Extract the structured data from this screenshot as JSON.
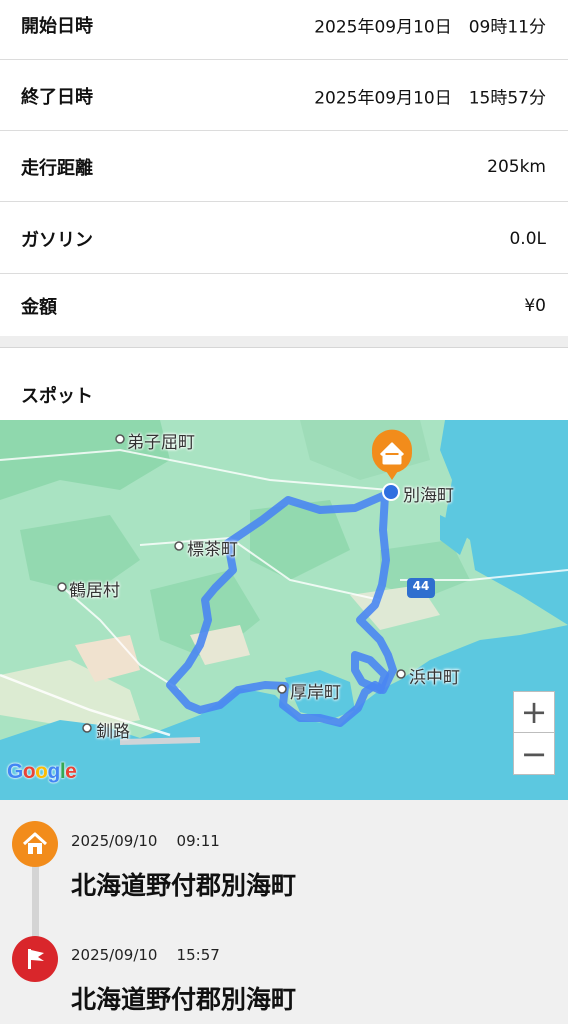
{
  "summary": {
    "start": {
      "label": "開始日時",
      "value": "2025年09月10日　09時11分"
    },
    "end": {
      "label": "終了日時",
      "value": "2025年09月10日　15時57分"
    },
    "distance": {
      "label": "走行距離",
      "value": "205km"
    },
    "gasoline": {
      "label": "ガソリン",
      "value": "0.0L"
    },
    "amount": {
      "label": "金額",
      "value": "¥0"
    }
  },
  "spot": {
    "title": "スポット",
    "map": {
      "labels": {
        "teshikaga": "弟子屈町",
        "betsukai": "別海町",
        "shibecha": "標茶町",
        "tsurui": "鶴居村",
        "hamanaka": "浜中町",
        "akkeshi": "厚岸町",
        "kushiro": "釧路",
        "route_shield": "44"
      },
      "zoom_in": "+",
      "zoom_out": "−",
      "attribution": "Google",
      "route_color": "#4a86f2",
      "start_pin_color": "#f28c1b"
    }
  },
  "timeline": [
    {
      "icon": "home-icon",
      "color": "#f28c1b",
      "date": "2025/09/10",
      "time": "09:11",
      "place": "北海道野付郡別海町"
    },
    {
      "icon": "flag-icon",
      "color": "#d9262b",
      "date": "2025/09/10",
      "time": "15:57",
      "place": "北海道野付郡別海町"
    }
  ]
}
